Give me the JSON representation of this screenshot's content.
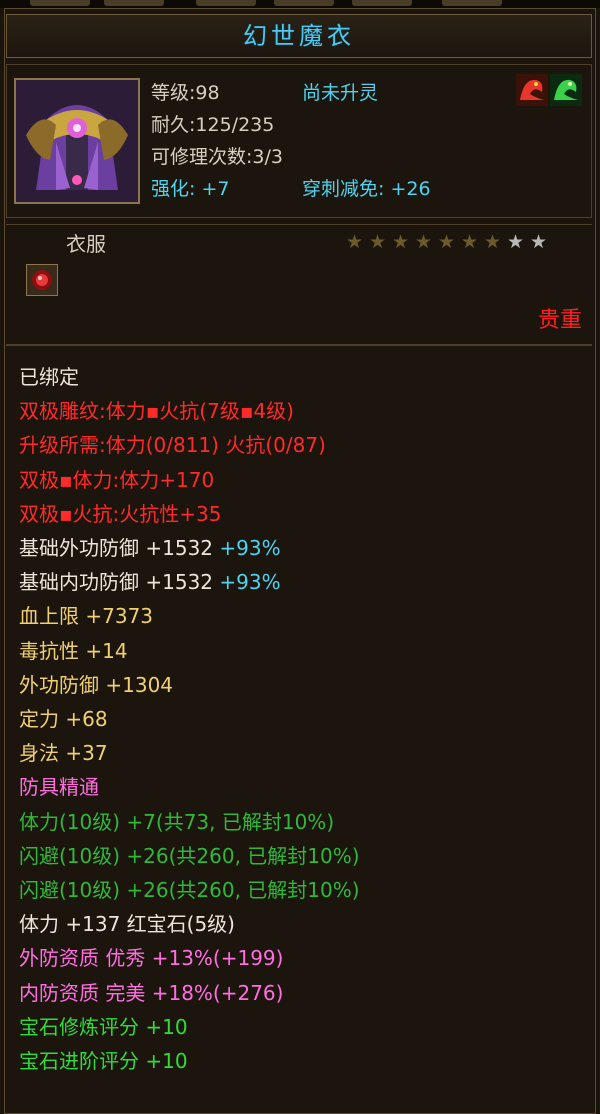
{
  "item": {
    "name": "幻世魔衣",
    "level": "等级:98",
    "spirit_status": "尚未升灵",
    "durability": "耐久:125/235",
    "repair_count": "可修理次数:3/3",
    "enhance": "强化: +7",
    "pierce_reduction": "穿刺减免: +26",
    "type": "衣服",
    "rarity": "贵重",
    "stars_total": 9,
    "stars_lit": 7
  },
  "icons": {
    "portrait": "armor-robe-icon",
    "slot": "red-gem-slot-icon",
    "gems": [
      "red-dragon-icon",
      "green-dragon-icon"
    ]
  },
  "colors": {
    "title": "#4fc8ee",
    "red": "#ff2a2a",
    "white": "#ebe6da",
    "yellow": "#f0d070",
    "cyan": "#4fd3ee",
    "pink": "#ff6ee0",
    "green": "#2fdc3a",
    "green_dim": "#2fb83a"
  },
  "attributes": [
    {
      "text": "已绑定",
      "color": "white"
    },
    {
      "text": "双极雕纹:体力▪火抗(7级▪4级)",
      "color": "red"
    },
    {
      "text": "升级所需:体力(0/811)  火抗(0/87)",
      "color": "red"
    },
    {
      "text": "双极▪体力:体力+170",
      "color": "red"
    },
    {
      "text": "双极▪火抗:火抗性+35",
      "color": "red"
    },
    {
      "text": "基础外功防御 +1532 ",
      "color": "white",
      "suffix": "+93%",
      "suffix_color": "cyan"
    },
    {
      "text": "基础内功防御 +1532 ",
      "color": "white",
      "suffix": "+93%",
      "suffix_color": "cyan"
    },
    {
      "text": "血上限 +7373",
      "color": "yellow"
    },
    {
      "text": "毒抗性 +14",
      "color": "yellow"
    },
    {
      "text": "外功防御 +1304",
      "color": "yellow"
    },
    {
      "text": "定力 +68",
      "color": "yellow"
    },
    {
      "text": "身法 +37",
      "color": "yellow"
    },
    {
      "text": "防具精通",
      "color": "pink"
    },
    {
      "text": "体力(10级) +7(共73, 已解封10%)",
      "color": "green_dim"
    },
    {
      "text": "闪避(10级) +26(共260, 已解封10%)",
      "color": "green_dim"
    },
    {
      "text": "闪避(10级) +26(共260, 已解封10%)",
      "color": "green_dim"
    },
    {
      "text": "体力 +137 红宝石(5级)",
      "color": "white"
    },
    {
      "text": "外防资质  优秀 +13%(+199)",
      "color": "pink"
    },
    {
      "text": "内防资质  完美 +18%(+276)",
      "color": "pink"
    },
    {
      "text": "宝石修炼评分 +10",
      "color": "green"
    },
    {
      "text": "宝石进阶评分 +10",
      "color": "green"
    }
  ]
}
